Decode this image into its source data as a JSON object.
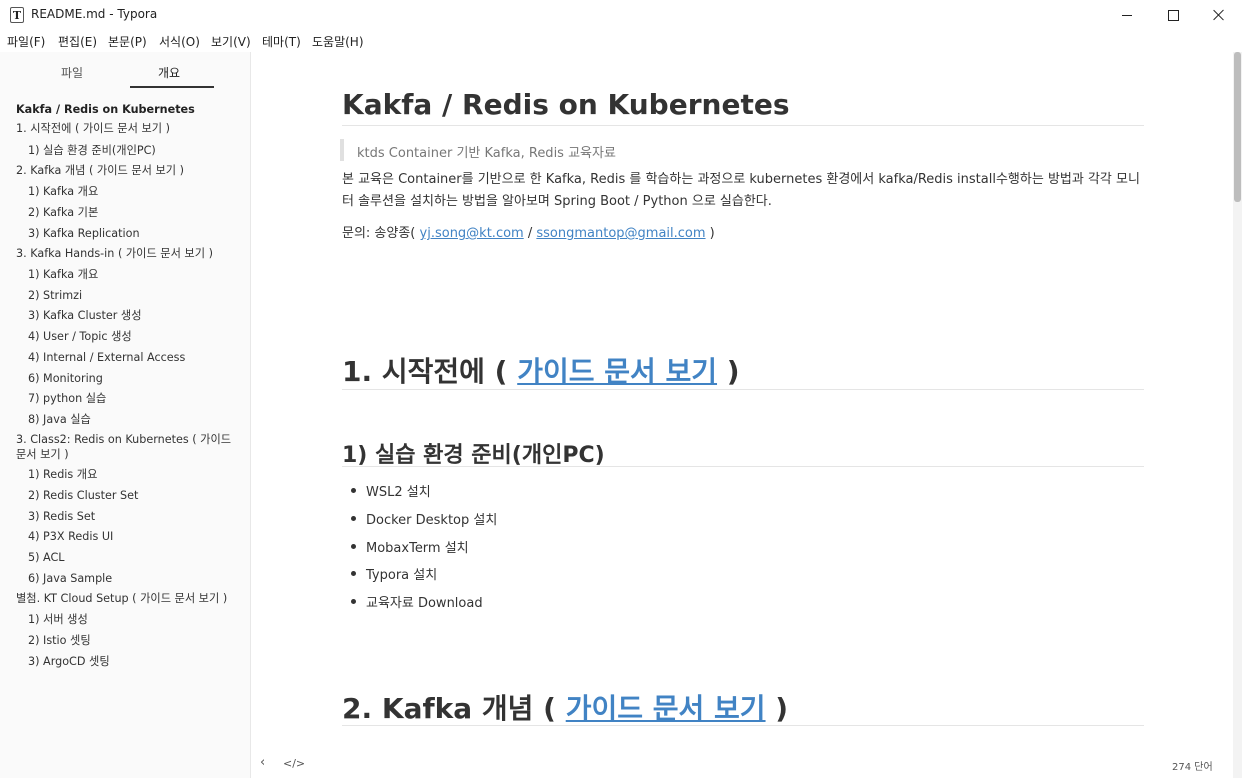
{
  "window": {
    "app_icon_letter": "T",
    "title": "README.md - Typora"
  },
  "menu": [
    "파일(F)",
    "편집(E)",
    "본문(P)",
    "서식(O)",
    "보기(V)",
    "테마(T)",
    "도움말(H)"
  ],
  "sidebar": {
    "tabs": [
      "파일",
      "개요"
    ],
    "active_tab": "개요",
    "toc": [
      "Kakfa / Redis on Kubernetes",
      "1. 시작전에 ( 가이드 문서 보기 )",
      "1) 실습 환경 준비(개인PC)",
      "2. Kafka 개념 ( 가이드 문서 보기 )",
      "1) Kafka 개요",
      "2) Kafka 기본",
      "3) Kafka Replication",
      "3. Kafka Hands-in ( 가이드 문서 보기 )",
      "1) Kafka 개요",
      "2) Strimzi",
      "3) Kafka Cluster 생성",
      "4) User / Topic 생성",
      "4) Internal / External Access",
      "6) Monitoring",
      "7) python 실습",
      "8) Java 실습",
      "3. Class2: Redis on Kubernetes ( 가이드 문서 보기 )",
      "1) Redis 개요",
      "2) Redis Cluster Set",
      "3) Redis Set",
      "4) P3X Redis UI",
      "5) ACL",
      "6) Java Sample",
      "별첨. KT Cloud Setup ( 가이드 문서 보기 )",
      "1) 서버 생성",
      "2) Istio 셋팅",
      "3) ArgoCD 셋팅"
    ]
  },
  "document": {
    "title": "Kakfa / Redis on Kubernetes",
    "quote": "ktds Container 기반 Kafka, Redis 교육자료",
    "intro": "본 교육은 Container를 기반으로 한 Kafka, Redis 를 학습하는 과정으로 kubernetes 환경에서 kafka/Redis  install수행하는 방법과  각각 모니터 솔루션을 설치하는 방법을 알아보며 Spring Boot / Python 으로 실습한다.",
    "contact_prefix": "문의: 송양종(",
    "contact_email1": "yj.song@kt.com",
    "contact_sep": " / ",
    "contact_email2": "ssongmantop@gmail.com",
    "contact_suffix": " )",
    "sec1_prefix": "1. 시작전에 ( ",
    "sec1_link": "가이드 문서 보기",
    "sec1_suffix": " )",
    "sub1": "1) 실습 환경 준비(개인PC)",
    "bullets": [
      "WSL2 설치",
      "Docker Desktop 설치",
      "MobaxTerm 설치",
      "Typora 설치",
      "교육자료 Download"
    ],
    "sec2_prefix": "2. Kafka 개념 ( ",
    "sec2_link": "가이드 문서 보기",
    "sec2_suffix": " )"
  },
  "statusbar": {
    "back_icon": "chevron-left-icon",
    "source_icon": "code-icon",
    "word_count": "274 단어"
  }
}
